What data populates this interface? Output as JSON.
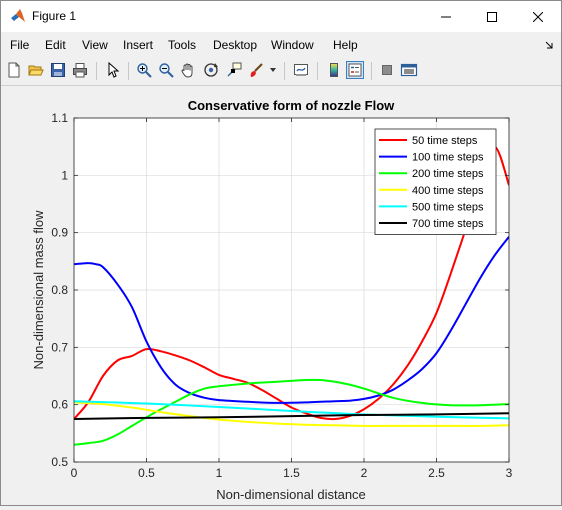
{
  "window": {
    "title": "Figure 1",
    "controls": [
      "minimize",
      "maximize",
      "close"
    ]
  },
  "menu": [
    "File",
    "Edit",
    "View",
    "Insert",
    "Tools",
    "Desktop",
    "Window",
    "Help"
  ],
  "toolbar": [
    "new-figure-icon",
    "open-file-icon",
    "save-icon",
    "print-icon",
    "select-arrow-icon",
    "zoom-in-icon",
    "zoom-out-icon",
    "pan-hand-icon",
    "rotate-3d-icon",
    "data-cursor-icon",
    "brush-icon",
    "link-plot-icon",
    "colorbar-icon",
    "legend-icon",
    "hide-plot-tools-icon",
    "show-plot-tools-icon"
  ],
  "colors": {
    "red": "#ff0000",
    "blue": "#0000ff",
    "green": "#00ff00",
    "yellow": "#ffff00",
    "cyan": "#00ffff",
    "black": "#000000"
  },
  "chart_data": {
    "type": "line",
    "title": "Conservative form of nozzle Flow",
    "xlabel": "Non-dimensional distance",
    "ylabel": "Non-dimensional mass flow",
    "xlim": [
      0,
      3
    ],
    "ylim": [
      0.5,
      1.1
    ],
    "xticks": [
      "0",
      "0.5",
      "1",
      "1.5",
      "2",
      "2.5",
      "3"
    ],
    "yticks": [
      "0.5",
      "0.6",
      "0.7",
      "0.8",
      "0.9",
      "1",
      "1.1"
    ],
    "grid": true,
    "legend_position": "top-right",
    "series": [
      {
        "name": "50 time steps",
        "color": "#ff0000",
        "x": [
          0,
          0.1,
          0.2,
          0.3,
          0.4,
          0.5,
          0.6,
          0.7,
          0.8,
          0.9,
          1.0,
          1.1,
          1.2,
          1.3,
          1.4,
          1.5,
          1.6,
          1.7,
          1.8,
          1.9,
          2.0,
          2.1,
          2.2,
          2.3,
          2.4,
          2.5,
          2.6,
          2.7,
          2.8,
          2.9,
          3.0
        ],
        "y": [
          0.575,
          0.605,
          0.65,
          0.677,
          0.685,
          0.697,
          0.693,
          0.686,
          0.677,
          0.665,
          0.652,
          0.645,
          0.638,
          0.625,
          0.61,
          0.595,
          0.585,
          0.577,
          0.575,
          0.58,
          0.592,
          0.61,
          0.635,
          0.668,
          0.71,
          0.76,
          0.83,
          0.905,
          0.98,
          1.05,
          0.983
        ]
      },
      {
        "name": "100 time steps",
        "color": "#0000ff",
        "x": [
          0,
          0.05,
          0.1,
          0.15,
          0.2,
          0.3,
          0.4,
          0.5,
          0.6,
          0.7,
          0.8,
          0.9,
          1.0,
          1.2,
          1.4,
          1.6,
          1.8,
          1.9,
          2.0,
          2.1,
          2.2,
          2.3,
          2.4,
          2.5,
          2.6,
          2.7,
          2.8,
          2.9,
          3.0
        ],
        "y": [
          0.845,
          0.846,
          0.847,
          0.845,
          0.84,
          0.81,
          0.77,
          0.71,
          0.665,
          0.635,
          0.62,
          0.612,
          0.608,
          0.605,
          0.603,
          0.604,
          0.606,
          0.607,
          0.61,
          0.616,
          0.626,
          0.642,
          0.662,
          0.69,
          0.73,
          0.775,
          0.82,
          0.86,
          0.893
        ]
      },
      {
        "name": "200 time steps",
        "color": "#00ff00",
        "x": [
          0,
          0.1,
          0.2,
          0.3,
          0.4,
          0.5,
          0.6,
          0.7,
          0.8,
          0.9,
          1.0,
          1.2,
          1.4,
          1.6,
          1.7,
          1.8,
          1.9,
          2.0,
          2.2,
          2.4,
          2.6,
          2.8,
          3.0
        ],
        "y": [
          0.53,
          0.533,
          0.537,
          0.548,
          0.563,
          0.578,
          0.592,
          0.605,
          0.618,
          0.628,
          0.632,
          0.637,
          0.64,
          0.643,
          0.643,
          0.64,
          0.635,
          0.628,
          0.612,
          0.603,
          0.599,
          0.599,
          0.601
        ]
      },
      {
        "name": "400 time steps",
        "color": "#ffff00",
        "x": [
          0,
          0.2,
          0.4,
          0.6,
          0.8,
          1.0,
          1.2,
          1.4,
          1.6,
          1.8,
          2.0,
          2.2,
          2.4,
          2.6,
          2.8,
          3.0
        ],
        "y": [
          0.604,
          0.601,
          0.595,
          0.587,
          0.58,
          0.574,
          0.57,
          0.567,
          0.565,
          0.564,
          0.563,
          0.563,
          0.563,
          0.563,
          0.563,
          0.564
        ]
      },
      {
        "name": "500 time steps",
        "color": "#00ffff",
        "x": [
          0,
          0.5,
          1.0,
          1.5,
          2.0,
          2.5,
          3.0
        ],
        "y": [
          0.606,
          0.602,
          0.596,
          0.589,
          0.583,
          0.579,
          0.576
        ]
      },
      {
        "name": "700 time steps",
        "color": "#000000",
        "x": [
          0,
          0.5,
          1.0,
          1.5,
          2.0,
          2.5,
          3.0
        ],
        "y": [
          0.575,
          0.577,
          0.578,
          0.58,
          0.582,
          0.583,
          0.585
        ]
      }
    ]
  }
}
